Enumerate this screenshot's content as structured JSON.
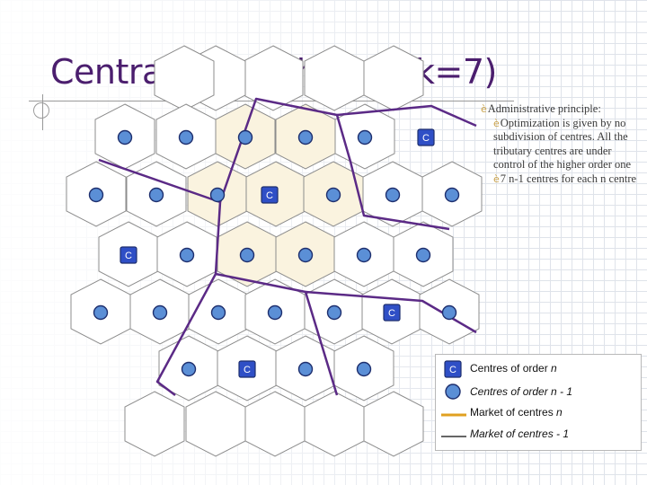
{
  "title": "Central-place theory (k=7)",
  "notes": [
    {
      "bullet": "è",
      "text": "Administrative principle:",
      "level": 0
    },
    {
      "bullet": "è",
      "text": "Optimization is given by no subdivision of centres. All the tributary centres are under control of the higher order one",
      "level": 1
    },
    {
      "bullet": "è",
      "text": "7 n-1 centres for each n centre",
      "level": 1
    }
  ],
  "higher_order_symbol": "C",
  "legend": {
    "centre_order_n_symbol": "C",
    "centre_order_n": {
      "text": "Centres of order ",
      "em": "n"
    },
    "centre_order_n_minus_1": "Centres of order n - 1",
    "market_n": {
      "text": "Market of centres ",
      "em": "n"
    },
    "market_n_minus_1": "Market of centres  - 1"
  },
  "colors": {
    "title": "#4b1e6e",
    "hex_fill": "#ffffff",
    "hex_highlight": "#faf3df",
    "hex_stroke": "#8c8c8c",
    "market_boundary": "#5b2a86",
    "centre_fill": "#5b8fd6",
    "centre_stroke": "#1e2f6e",
    "higher_centre_fill": "#2f4fc6",
    "legend_market_n": "#e0a020",
    "legend_market_n_minus_1": "#666666"
  }
}
